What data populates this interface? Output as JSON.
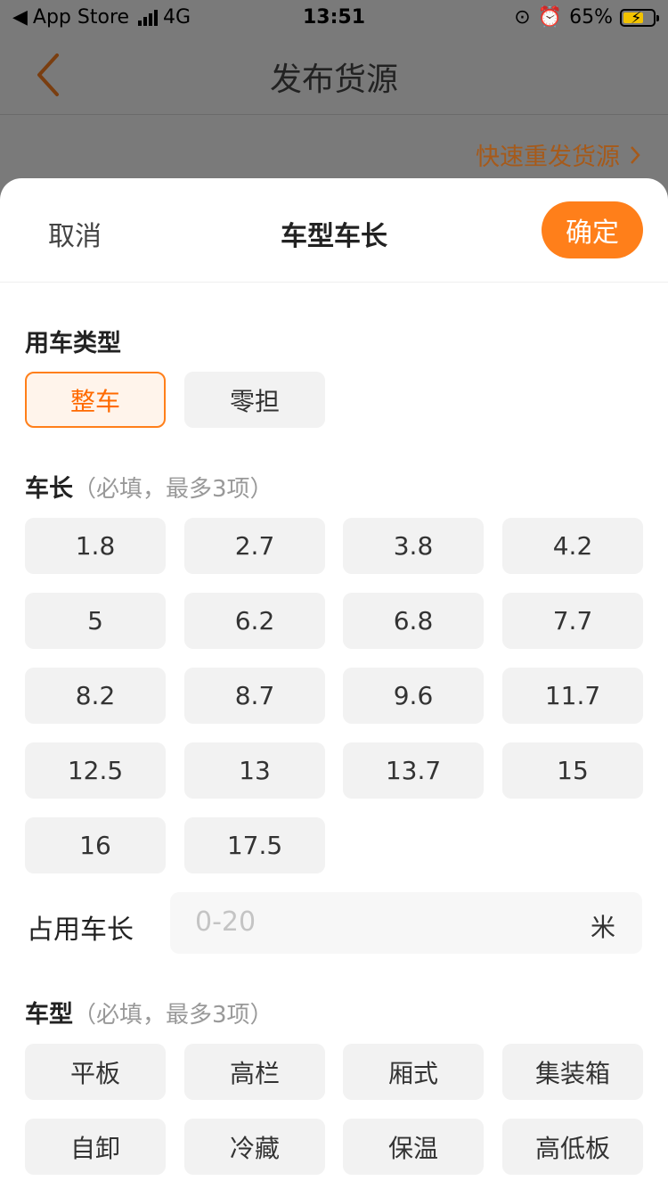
{
  "status_bar": {
    "carrier": "App Store",
    "network": "4G",
    "time": "13:51",
    "battery": "65%"
  },
  "nav": {
    "title": "发布货源",
    "quick_resend": "快速重发货源"
  },
  "sheet": {
    "cancel": "取消",
    "title": "车型车长",
    "confirm": "确定"
  },
  "use_type": {
    "label": "用车类型",
    "options": [
      "整车",
      "零担"
    ],
    "selected": "整车"
  },
  "length": {
    "label": "车长",
    "hint": "（必填，最多3项）",
    "options": [
      "1.8",
      "2.7",
      "3.8",
      "4.2",
      "5",
      "6.2",
      "6.8",
      "7.7",
      "8.2",
      "8.7",
      "9.6",
      "11.7",
      "12.5",
      "13",
      "13.7",
      "15",
      "16",
      "17.5"
    ]
  },
  "occupy": {
    "label": "占用车长",
    "placeholder": "0-20",
    "unit": "米"
  },
  "vehicle_type": {
    "label": "车型",
    "hint": "（必填，最多3项）",
    "options": [
      "平板",
      "高栏",
      "厢式",
      "集装箱",
      "自卸",
      "冷藏",
      "保温",
      "高低板"
    ]
  },
  "colors": {
    "accent": "#ff7f1a"
  }
}
